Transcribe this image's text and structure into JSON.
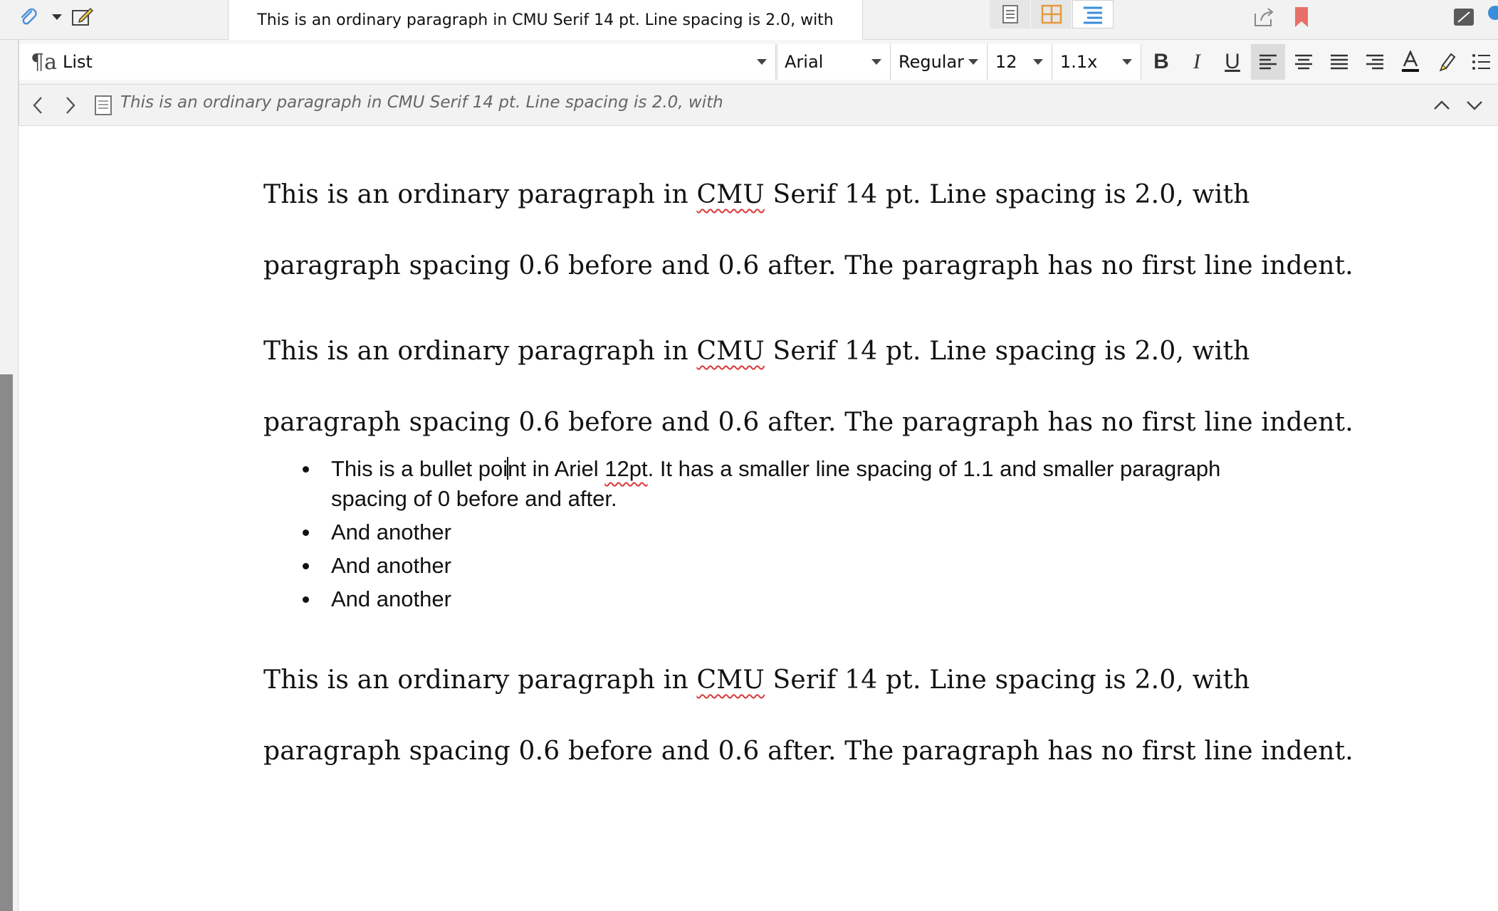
{
  "window": {
    "title": "This is an ordinary paragraph in CMU Serif 14 pt. Line spacing is 2.0, with",
    "icons": [
      "paperclip-icon",
      "dropdown-arrow-icon",
      "compose-icon",
      "page-view-icon",
      "grid-view-icon",
      "outline-view-icon",
      "share-icon",
      "bookmark-icon",
      "panel-toggle-icon"
    ]
  },
  "toolbar": {
    "style_glyph": "¶a",
    "style": "List",
    "font": "Arial",
    "weight": "Regular",
    "size": "12",
    "line_spacing": "1.1x",
    "bold": "B",
    "italic": "I",
    "underline": "U",
    "alignment": "left"
  },
  "nav": {
    "path": "This is an ordinary paragraph in CMU Serif 14 pt. Line spacing is 2.0, with"
  },
  "document": {
    "p1": {
      "l1_pre": "This is an ordinary paragraph in ",
      "l1_cmu": "CMU",
      "l1_post": " Serif 14 pt. Line spacing is 2.0, with",
      "l2": "paragraph spacing 0.6 before and 0.6 after. The paragraph has no first line indent."
    },
    "p2": {
      "l1_pre": "This is an ordinary paragraph in ",
      "l1_cmu": "CMU",
      "l1_post": " Serif 14 pt. Line spacing is 2.0, with",
      "l2": "paragraph spacing 0.6 before and 0.6 after. The paragraph has no first line indent."
    },
    "bullets": {
      "b1_a": "This is a bullet poi",
      "b1_b": "nt in Ariel ",
      "b1_c": "12pt",
      "b1_d": ". It has a smaller line spacing of 1.1 and smaller paragraph spacing of 0 before and after.",
      "b2": "And another",
      "b3": "And another",
      "b4": "And another"
    },
    "p3": {
      "l1_pre": "This is an ordinary paragraph in ",
      "l1_cmu": "CMU",
      "l1_post": " Serif 14 pt. Line spacing is 2.0, with",
      "l2": "paragraph spacing 0.6 before and 0.6 after. The paragraph has no first line indent."
    }
  }
}
